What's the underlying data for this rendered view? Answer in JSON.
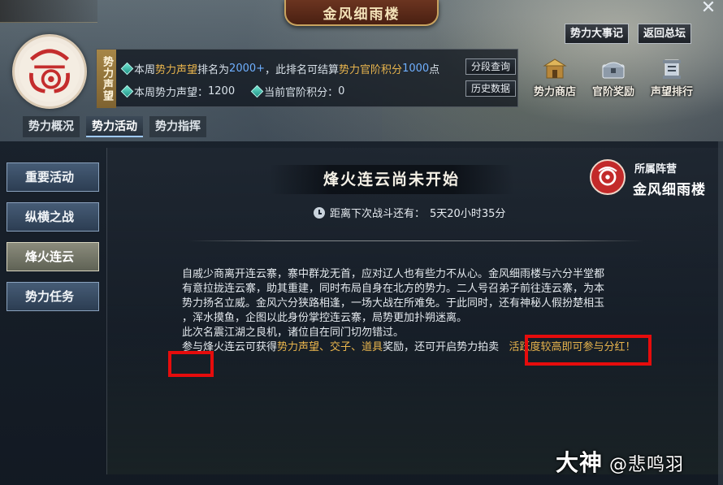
{
  "window": {
    "title": "金风细雨楼",
    "close_glyph": "✕"
  },
  "header": {
    "info_label": "势力声望",
    "line1": {
      "prefix": "本周",
      "hl1": "势力声望",
      "mid1": "排名为",
      "rank": "2000+",
      "mid2": "，此排名可结算",
      "hl2": "势力官阶积分",
      "points": "1000",
      "suffix": "点"
    },
    "line2": {
      "weekly_label": "本周势力声望：",
      "weekly_value": "1200",
      "rank_points_label": "当前官阶积分：",
      "rank_points_value": "0"
    },
    "btn_segment": "分段查询",
    "btn_history": "历史数据",
    "btn_events": "势力大事记",
    "btn_return": "返回总坛",
    "shop": [
      {
        "label": "势力商店",
        "icon": "shop-icon"
      },
      {
        "label": "官阶奖励",
        "icon": "chest-icon"
      },
      {
        "label": "声望排行",
        "icon": "ranking-icon"
      }
    ]
  },
  "tabs": [
    {
      "label": "势力概况",
      "active": false
    },
    {
      "label": "势力活动",
      "active": true
    },
    {
      "label": "势力指挥",
      "active": false
    }
  ],
  "side_nav": [
    {
      "label": "重要活动",
      "active": false
    },
    {
      "label": "纵横之战",
      "active": false
    },
    {
      "label": "烽火连云",
      "active": true
    },
    {
      "label": "势力任务",
      "active": false
    }
  ],
  "content": {
    "title": "烽火连云尚未开始",
    "countdown_label": "距离下次战斗还有：",
    "countdown_value": "5天20小时35分",
    "faction_label": "所属阵营",
    "faction_name": "金风细雨楼",
    "desc_lines": [
      "自戚少商离开连云寨，寨中群龙无首，应对辽人也有些力不从心。金风细雨楼与六分半堂都",
      "有意拉拢连云寨，助其重建，同时布局自身在北方的势力。二人号召弟子前往连云寨，为本",
      "势力扬名立威。金风六分狭路相逢，一场大战在所难免。于此同时，还有神秘人假扮楚相玉",
      "，浑水摸鱼，企图以此身份掌控连云寨，局势更加扑朔迷离。",
      "此次名震江湖之良机，诸位自在同门切勿错过。"
    ],
    "reward": {
      "prefix": "参与烽火连云可获得",
      "r1": "势力声望",
      "sep1": "、",
      "r2": "交子",
      "sep2": "、",
      "r3": "道具",
      "mid": "奖励，还可开启势力拍卖",
      "dividend": "活跃度较高即可参与分红！"
    }
  },
  "watermark": {
    "brand": "大神",
    "user": "@悲鸣羽"
  },
  "colors": {
    "accent_gold": "#e9b54d",
    "accent_blue": "#6fb0ff",
    "highlight_red": "#e60c0c"
  }
}
